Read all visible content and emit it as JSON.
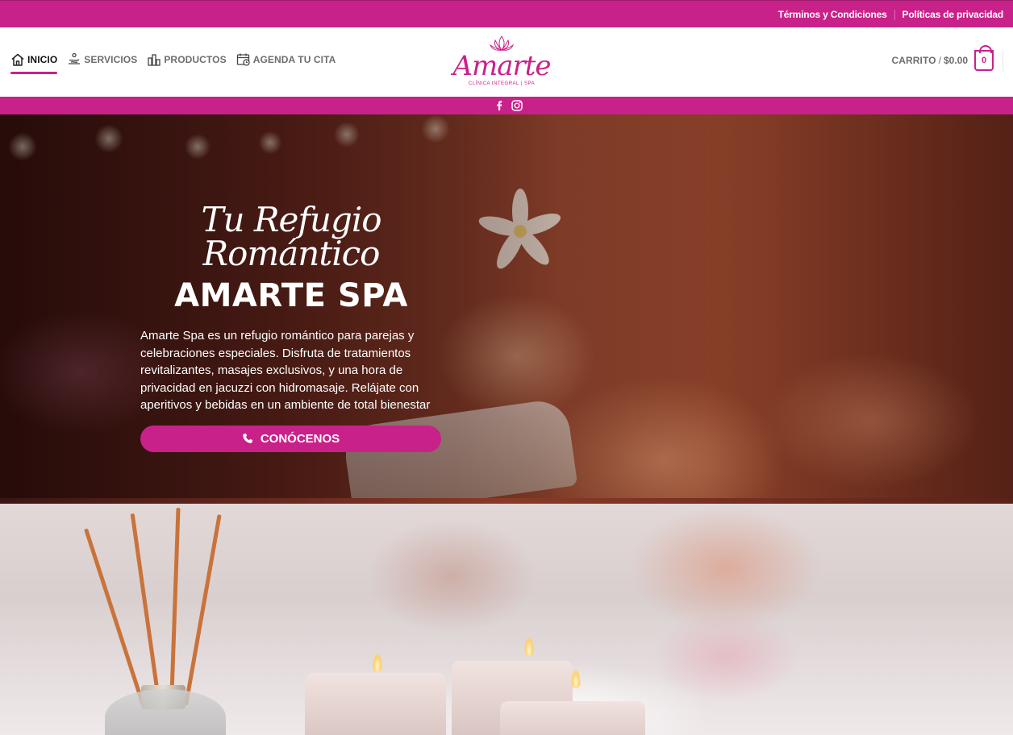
{
  "topbar": {
    "links": [
      "Términos y Condiciones",
      "Políticas de privacidad"
    ]
  },
  "nav": {
    "items": [
      {
        "label": "INICIO",
        "icon": "home-icon",
        "active": true
      },
      {
        "label": "SERVICIOS",
        "icon": "spa-icon",
        "active": false
      },
      {
        "label": "PRODUCTOS",
        "icon": "products-icon",
        "active": false
      },
      {
        "label": "AGENDA TU CITA",
        "icon": "calendar-clock-icon",
        "active": false
      }
    ]
  },
  "logo": {
    "name": "Amarte",
    "subtitle": "CLÍNICA INTEGRAL | SPA"
  },
  "cart": {
    "label": "CARRITO",
    "separator": "/",
    "amount": "$0.00",
    "count": "0"
  },
  "social": {
    "icons": [
      "facebook-icon",
      "instagram-icon"
    ]
  },
  "hero": {
    "script_title": "Tu Refugio Romántico",
    "title": "AMARTE SPA",
    "description": "Amarte Spa es un refugio romántico para parejas y celebraciones especiales. Disfruta de tratamientos revitalizantes, masajes exclusivos, y una hora de privacidad en jacuzzi con hidromasaje. Relájate con aperitivos y bebidas en un ambiente de total bienestar",
    "button_label": "CONÓCENOS",
    "button_icon": "phone-icon"
  },
  "colors": {
    "brand": "#c9218a",
    "text_muted": "#6d6d6d"
  }
}
